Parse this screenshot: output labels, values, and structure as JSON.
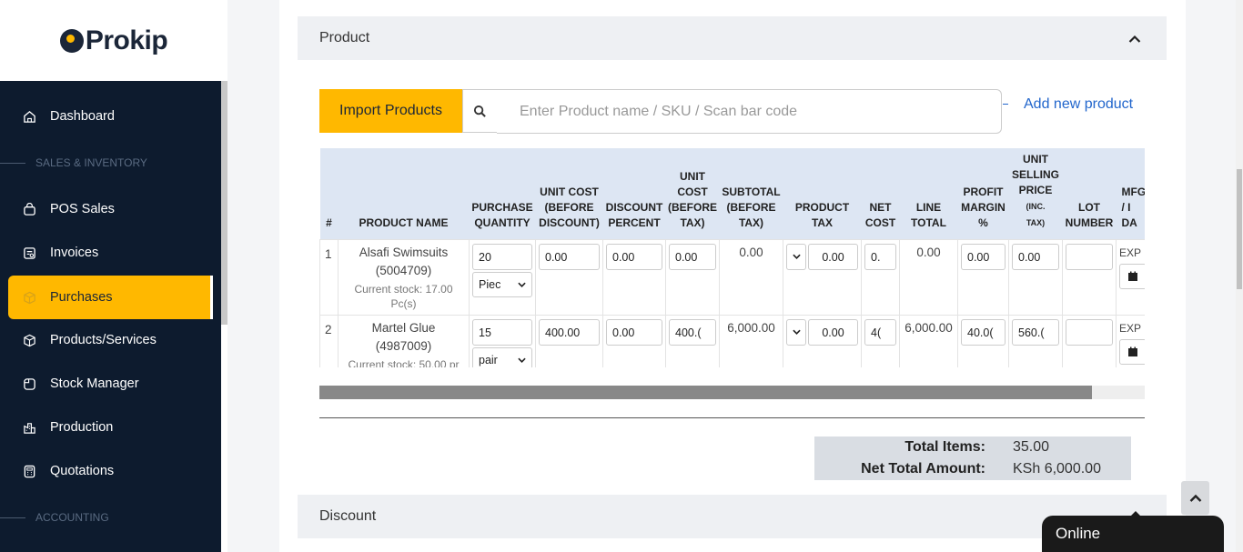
{
  "brand": {
    "name": "Prokip"
  },
  "sidebar": {
    "items": [
      {
        "label": "Dashboard",
        "icon": "home-icon"
      },
      {
        "label": "POS Sales",
        "icon": "bag-icon"
      },
      {
        "label": "Invoices",
        "icon": "invoice-icon"
      },
      {
        "label": "Purchases",
        "icon": "box-icon",
        "active": true
      },
      {
        "label": "Products/Services",
        "icon": "cube-icon"
      },
      {
        "label": "Stock Manager",
        "icon": "stock-icon"
      },
      {
        "label": "Production",
        "icon": "factory-icon"
      },
      {
        "label": "Quotations",
        "icon": "calculator-icon"
      }
    ],
    "sections": [
      "SALES & INVENTORY",
      "ACCOUNTING"
    ]
  },
  "product_panel": {
    "title": "Product",
    "import_label": "Import Products",
    "search_placeholder": "Enter Product name / SKU / Scan bar code",
    "add_new_label": "Add new product"
  },
  "table": {
    "headers": {
      "num": "#",
      "name": "PRODUCT NAME",
      "qty": [
        "PURCHASE",
        "QUANTITY"
      ],
      "unit_cost_before_disc": [
        "UNIT COST",
        "(BEFORE",
        "DISCOUNT)"
      ],
      "discount": [
        "DISCOUNT",
        "PERCENT"
      ],
      "unit_cost_before_tax": [
        "UNIT",
        "COST",
        "(BEFORE",
        "TAX)"
      ],
      "subtotal": [
        "SUBTOTAL",
        "(BEFORE",
        "TAX)"
      ],
      "product_tax": [
        "PRODUCT",
        "TAX"
      ],
      "net_cost": [
        "NET",
        "COST"
      ],
      "line_total": [
        "LINE",
        "TOTAL"
      ],
      "profit_margin": [
        "PROFIT",
        "MARGIN",
        "%"
      ],
      "unit_selling": [
        "UNIT",
        "SELLING",
        "PRICE",
        "(INC.",
        "TAX)"
      ],
      "lot": [
        "LOT",
        "NUMBER"
      ],
      "mfg": [
        "MFG",
        "/ I",
        "DA"
      ]
    },
    "rows": [
      {
        "num": "1",
        "name": "Alsafi Swimsuits",
        "sku": "(5004709)",
        "stock": "Current stock: 17.00 Pc(s)",
        "qty": "20",
        "unit": "Piec",
        "unit_cost": "0.00",
        "discount": "0.00",
        "cost_before_tax": "0.00",
        "subtotal": "0.00",
        "tax": "0.00",
        "net_cost": "0.",
        "line_total": "0.00",
        "margin": "0.00",
        "selling": "0.00",
        "lot": "",
        "exp": "EXP"
      },
      {
        "num": "2",
        "name": "Martel Glue",
        "sku": "(4987009)",
        "stock": "Current stock: 50.00 pr",
        "qty": "15",
        "unit": "pair",
        "unit_cost": "400.00",
        "discount": "0.00",
        "cost_before_tax": "400.(",
        "subtotal": "6,000.00",
        "tax": "0.00",
        "net_cost": "4(",
        "line_total": "6,000.00",
        "margin": "40.0(",
        "selling": "560.(",
        "lot": "",
        "exp": "EXP"
      }
    ]
  },
  "totals": {
    "items_label": "Total Items:",
    "items_value": "35.00",
    "net_label": "Net Total Amount:",
    "net_value": "KSh 6,000.00"
  },
  "discount_panel": {
    "title": "Discount"
  },
  "chat": {
    "label": "Online"
  }
}
